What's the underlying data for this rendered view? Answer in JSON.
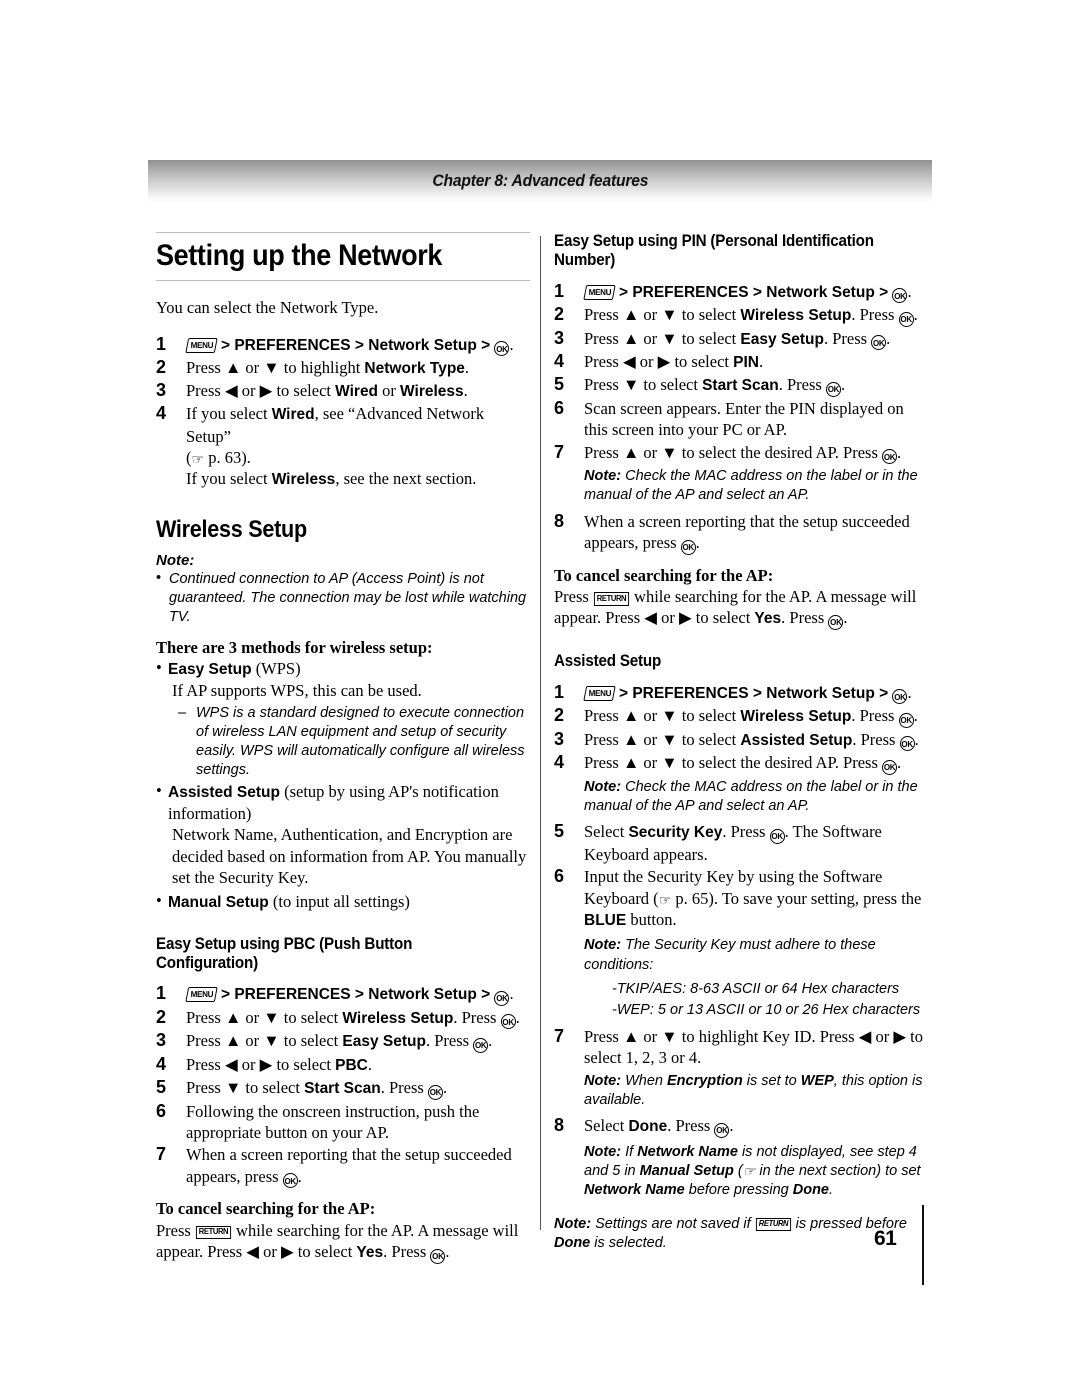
{
  "header": {
    "chapter": "Chapter 8: Advanced features"
  },
  "footer": {
    "page_number": "61"
  },
  "icons": {
    "menu": "MENU",
    "ok": "OK",
    "return": "RETURN",
    "pointer": "☞"
  },
  "left_column": {
    "title": "Setting up the Network",
    "intro": "You can select the Network Type.",
    "steps": [
      {
        "num": "1",
        "text_pre": "",
        "menu": true,
        "text": " > PREFERENCES > Network Setup > ",
        "ok": true,
        "tail": "."
      },
      {
        "num": "2",
        "text": "Press ▲ or ▼ to highlight Network Type."
      },
      {
        "num": "3",
        "text": "Press ◀ or ▶ to select Wired or Wireless."
      },
      {
        "num": "4",
        "text": "If you select Wired, see “Advanced Network Setup” (☞ p. 63)."
      },
      {
        "num": "4b",
        "text": "If you select Wireless, see the next section."
      }
    ],
    "step_labels": {
      "s1_prefs": "PREFERENCES",
      "s1_network_setup": "Network Setup",
      "s2_pre": "Press ▲ or ▼ to highlight ",
      "s2_bold": "Network Type",
      "s2_post": ".",
      "s3_pre": "Press ◀ or ▶ to select ",
      "s3_bold1": "Wired",
      "s3_mid": " or ",
      "s3_bold2": "Wireless",
      "s3_post": ".",
      "s4_pre": "If you select ",
      "s4_bold": "Wired",
      "s4_mid": ", see “Advanced Network Setup”",
      "s4_page": " p. 63).",
      "s4_paren": "(",
      "s4b_pre": "If you select ",
      "s4b_bold": "Wireless",
      "s4b_post": ", see the next section."
    },
    "wireless_title": "Wireless Setup",
    "note_label": "Note:",
    "note_bullet": "Continued connection to AP (Access Point) is not guaranteed. The connection may be lost while watching TV.",
    "methods_head": "There are 3 methods for wireless setup:",
    "method1_bold": "Easy Setup",
    "method1_rest": " (WPS)",
    "method1_line": "If AP supports WPS, this can be used.",
    "method1_dash": "WPS is a standard designed to execute connection of wireless LAN equipment and setup of security easily. WPS will automatically configure all wireless settings.",
    "method2_bold": "Assisted Setup",
    "method2_rest": " (setup by using AP's notification information)",
    "method2_line": "Network Name, Authentication, and Encryption are decided based on information from AP. You manually set the Security Key.",
    "method3_bold": "Manual Setup",
    "method3_rest": " (to input all settings)",
    "pbc_title": "Easy Setup using PBC (Push Button Configuration)",
    "pbc_steps": {
      "s1_prefs": "PREFERENCES",
      "s1_network_setup": "Network Setup",
      "s2_pre": "Press ▲ or ▼ to select ",
      "s2_bold": "Wireless Setup",
      "s2_mid": ". Press ",
      "s2_post": ".",
      "s3_pre": "Press ▲ or ▼ to select ",
      "s3_bold": "Easy Setup",
      "s3_mid": ". Press ",
      "s3_post": ".",
      "s4_pre": "Press ◀ or ▶ to select ",
      "s4_bold": "PBC",
      "s4_post": ".",
      "s5_pre": "Press ▼ to select ",
      "s5_bold": "Start Scan",
      "s5_mid": ". Press ",
      "s5_post": ".",
      "s6": "Following the onscreen instruction, push the appropriate button on your AP.",
      "s7_pre": "When a screen reporting that the setup succeeded appears, press ",
      "s7_post": "."
    },
    "cancel_head": "To cancel searching for the AP:",
    "cancel_pre": "Press ",
    "cancel_mid": " while searching for the AP. A message will appear. Press ◀ or ▶ to select ",
    "cancel_bold": "Yes",
    "cancel_mid2": ". Press ",
    "cancel_post": "."
  },
  "right_column": {
    "pin_title": "Easy Setup using PIN (Personal Identification Number)",
    "pin_steps": {
      "s1_prefs": "PREFERENCES",
      "s1_network_setup": "Network Setup",
      "s2_pre": "Press ▲ or ▼ to select ",
      "s2_bold": "Wireless Setup",
      "s2_mid": ". Press ",
      "s2_post": ".",
      "s3_pre": "Press ▲ or ▼ to select ",
      "s3_bold": "Easy Setup",
      "s3_mid": ". Press ",
      "s3_post": ".",
      "s4_pre": "Press ◀ or ▶ to select ",
      "s4_bold": "PIN",
      "s4_post": ".",
      "s5_pre": "Press ▼ to select ",
      "s5_bold": "Start Scan",
      "s5_mid": ". Press ",
      "s5_post": ".",
      "s6": "Scan screen appears. Enter the PIN displayed on this screen into your PC or AP.",
      "s7_pre": "Press ▲ or ▼ to select the desired AP. Press ",
      "s7_post": ".",
      "s7_note_label": "Note:",
      "s7_note": " Check the MAC address on the label or in the manual of the AP and select an AP.",
      "s8_pre": "When a screen reporting that the setup succeeded appears, press ",
      "s8_post": "."
    },
    "cancel_head": "To cancel searching for the AP:",
    "cancel_pre": "Press ",
    "cancel_mid": " while searching for the AP. A message will appear. Press ◀ or ▶ to select ",
    "cancel_bold": "Yes",
    "cancel_mid2": ". Press ",
    "cancel_post": ".",
    "assisted_title": "Assisted Setup",
    "assisted_steps": {
      "s1_prefs": "PREFERENCES",
      "s1_network_setup": "Network Setup",
      "s2_pre": "Press ▲ or ▼ to select ",
      "s2_bold": "Wireless Setup",
      "s2_mid": ". Press ",
      "s2_post": ".",
      "s3_pre": "Press ▲ or ▼ to select ",
      "s3_bold": "Assisted Setup",
      "s3_mid": ". Press ",
      "s3_post": ".",
      "s4_pre": "Press ▲ or ▼ to select the desired AP. Press ",
      "s4_post": ".",
      "s4_note_label": "Note:",
      "s4_note": " Check the MAC address on the label or in the manual of the AP and select an AP.",
      "s5_pre": "Select ",
      "s5_bold": "Security Key",
      "s5_mid": ". Press ",
      "s5_post": ". The Software Keyboard appears.",
      "s6_pre": "Input the Security Key by using the Software Keyboard (",
      "s6_page": " p. 65). To save your setting, press the ",
      "s6_bold": "BLUE",
      "s6_post": " button.",
      "s6_note_label": "Note:",
      "s6_note": " The Security Key must adhere to these conditions:",
      "cond1": "-TKIP/AES: 8-63 ASCII or 64 Hex characters",
      "cond2": "-WEP: 5 or 13 ASCII or 10 or 26 Hex characters",
      "s7_pre": "Press ▲ or ▼ to highlight Key ID. Press ◀ or ▶ to select 1, 2, 3 or 4.",
      "s7_note_label": "Note:",
      "s7_note_a": " When ",
      "s7_note_b1": "Encryption",
      "s7_note_c": " is set to ",
      "s7_note_b2": "WEP",
      "s7_note_d": ", this option is available.",
      "s8_pre": "Select ",
      "s8_bold": "Done",
      "s8_mid": ". Press ",
      "s8_post": ".",
      "s8_note_label": "Note:",
      "s8_note_a": " If ",
      "s8_note_b1": "Network Name",
      "s8_note_c": " is not displayed, see step 4 and 5 in ",
      "s8_note_b2": "Manual Setup",
      "s8_note_d": " (",
      "s8_note_e": " in the next section) to set ",
      "s8_note_b3": "Network Name",
      "s8_note_f": " before pressing ",
      "s8_note_b4": "Done",
      "s8_note_g": "."
    },
    "final_note_label": "Note:",
    "final_note_a": " Settings are not saved if ",
    "final_note_b": " is pressed before ",
    "final_note_bold": "Done",
    "final_note_c": " is selected."
  }
}
